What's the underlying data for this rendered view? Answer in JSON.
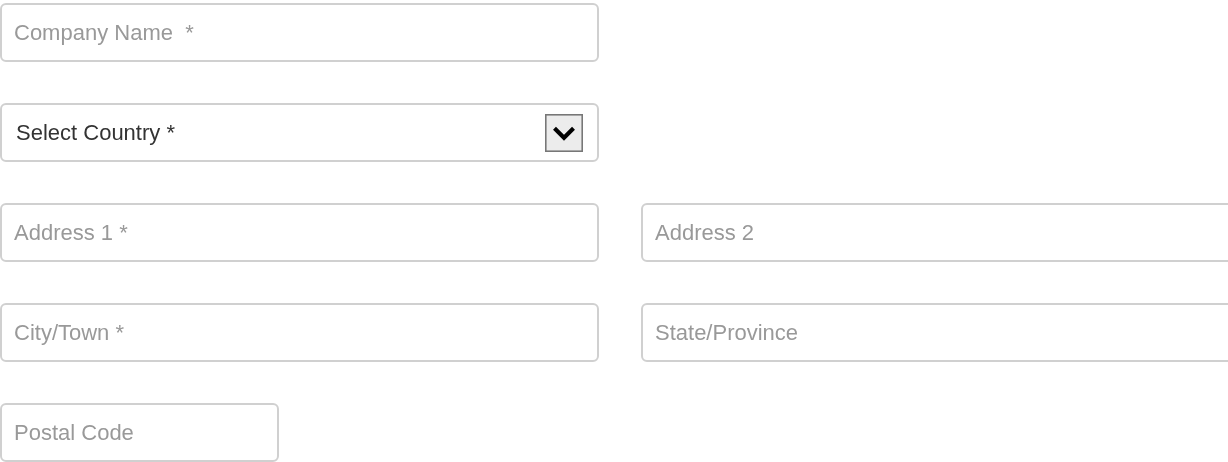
{
  "form": {
    "rows": [
      [
        {
          "kind": "text",
          "placeholder": "Company Name  *"
        }
      ],
      [
        {
          "kind": "select",
          "value": "Select Country *"
        }
      ],
      [
        {
          "kind": "text",
          "placeholder": "Address 1 *"
        },
        {
          "kind": "text",
          "placeholder": "Address 2"
        }
      ],
      [
        {
          "kind": "text",
          "placeholder": "City/Town *"
        },
        {
          "kind": "text",
          "placeholder": "State/Province"
        }
      ],
      [
        {
          "kind": "short",
          "placeholder": "Postal Code"
        }
      ]
    ]
  }
}
